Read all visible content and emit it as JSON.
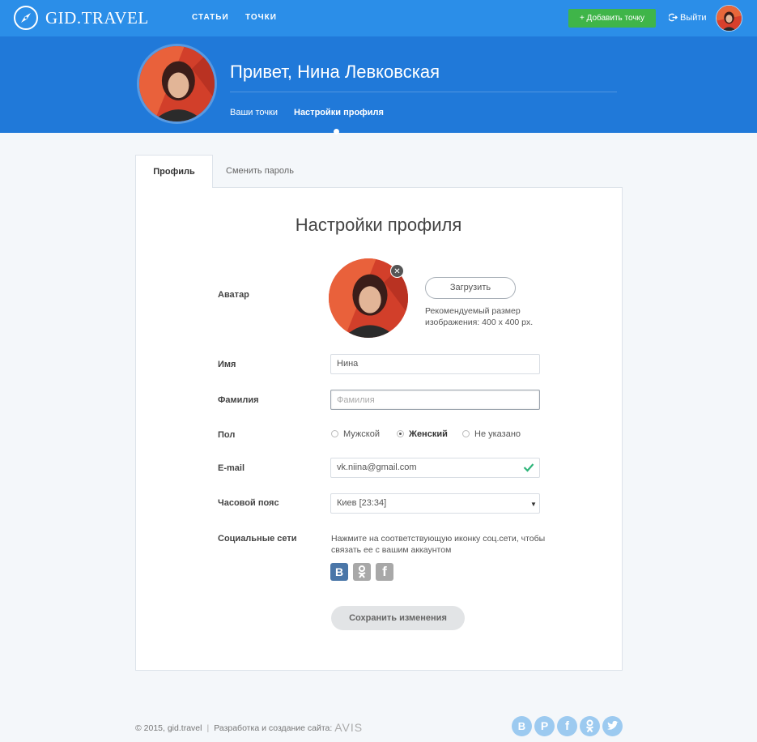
{
  "header": {
    "logo_text": "GID.TRAVEL",
    "nav": [
      "статьи",
      "точки"
    ],
    "add_button": "+ Добавить точку",
    "logout": "Выйти"
  },
  "profile_header": {
    "greeting": "Привет, Нина Левковская",
    "tabs": [
      "Ваши точки",
      "Настройки профиля"
    ],
    "active_tab": "Настройки профиля"
  },
  "tabs": {
    "profile": "Профиль",
    "change_password": "Сменить пароль"
  },
  "form": {
    "title": "Настройки профиля",
    "avatar_label": "Аватар",
    "upload_button": "Загрузить",
    "upload_hint_1": "Рекомендуемый размер",
    "upload_hint_2": "изображения: 400 x 400 px.",
    "name_label": "Имя",
    "name_value": "Нина",
    "surname_label": "Фамилия",
    "surname_placeholder": "Фамилия",
    "gender_label": "Пол",
    "gender_options": [
      "Мужской",
      "Женский",
      "Не указано"
    ],
    "gender_selected": "Женский",
    "email_label": "E-mail",
    "email_value": "vk.niina@gmail.com",
    "timezone_label": "Часовой пояс",
    "timezone_value": "Киев [23:34]",
    "social_label": "Социальные сети",
    "social_hint_1": "Нажмите на соответствующую иконку соц.сети, чтобы",
    "social_hint_2": "связать ее с вашим аккаунтом",
    "social_icons": [
      "vk-icon",
      "odnoklassniki-icon",
      "facebook-icon"
    ],
    "save_button": "Сохранить изменения"
  },
  "footer": {
    "copyright": "© 2015, gid.travel",
    "dev_text": "Разработка и создание сайта:",
    "dev_brand": "AVIS",
    "social_icons": [
      "vk-icon",
      "pinterest-icon",
      "facebook-icon",
      "odnoklassniki-icon",
      "twitter-icon"
    ]
  },
  "colors": {
    "topbar": "#2b8ee8",
    "band": "#2079d9",
    "add_button": "#3fb549",
    "vk": "#4a76a8",
    "social_gray": "#a8a8a8",
    "check": "#2fb57a",
    "footer_social": "#9ccaf0"
  }
}
